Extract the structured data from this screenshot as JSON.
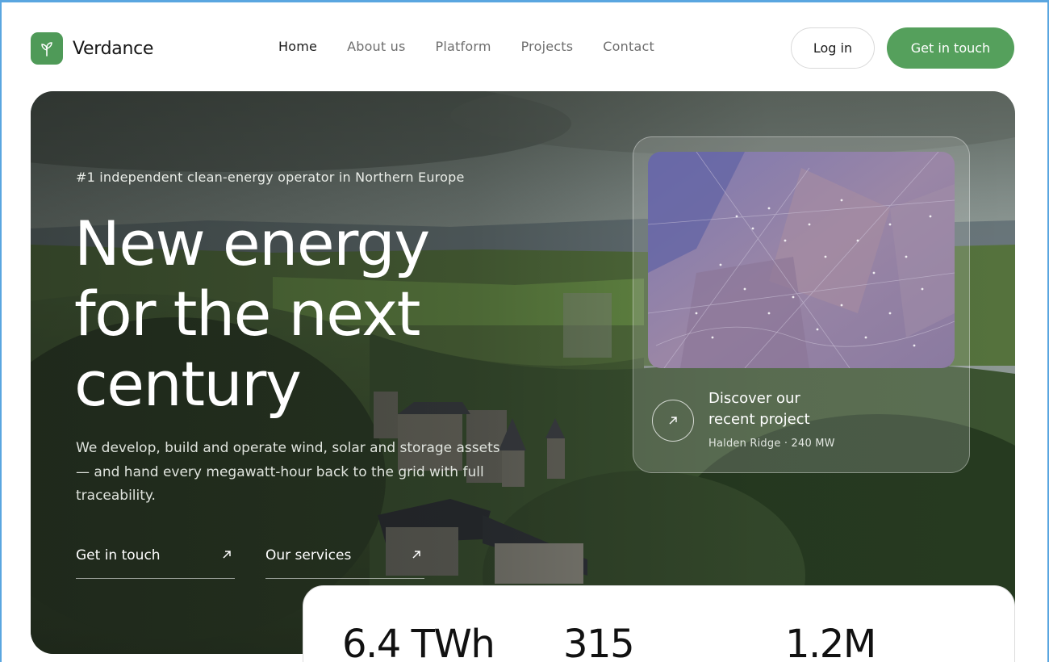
{
  "brand": {
    "name": "Verdance",
    "logo_icon": "sprout-icon",
    "accent": "#55a05c"
  },
  "nav": {
    "items": [
      {
        "label": "Home",
        "active": true
      },
      {
        "label": "About us",
        "active": false
      },
      {
        "label": "Platform",
        "active": false
      },
      {
        "label": "Projects",
        "active": false
      },
      {
        "label": "Contact",
        "active": false
      }
    ],
    "login_label": "Log in",
    "cta_label": "Get in touch"
  },
  "hero": {
    "eyebrow": "#1 independent clean-energy operator in Northern Europe",
    "headline": [
      "New energy",
      "for the next",
      "century"
    ],
    "lede": "We develop, build and operate wind, solar and storage assets — and hand every megawatt-hour back to the grid with full traceability.",
    "ctas": [
      {
        "label": "Get in touch",
        "icon": "arrow-up-right-icon"
      },
      {
        "label": "Our services",
        "icon": "arrow-up-right-icon"
      }
    ]
  },
  "project_card": {
    "title_line1": "Discover our",
    "title_line2": "recent project",
    "meta": "Halden Ridge · 240 MW",
    "icon": "arrow-up-right-icon"
  },
  "stats": [
    "6.4 TWh",
    "315",
    "1.2M"
  ]
}
